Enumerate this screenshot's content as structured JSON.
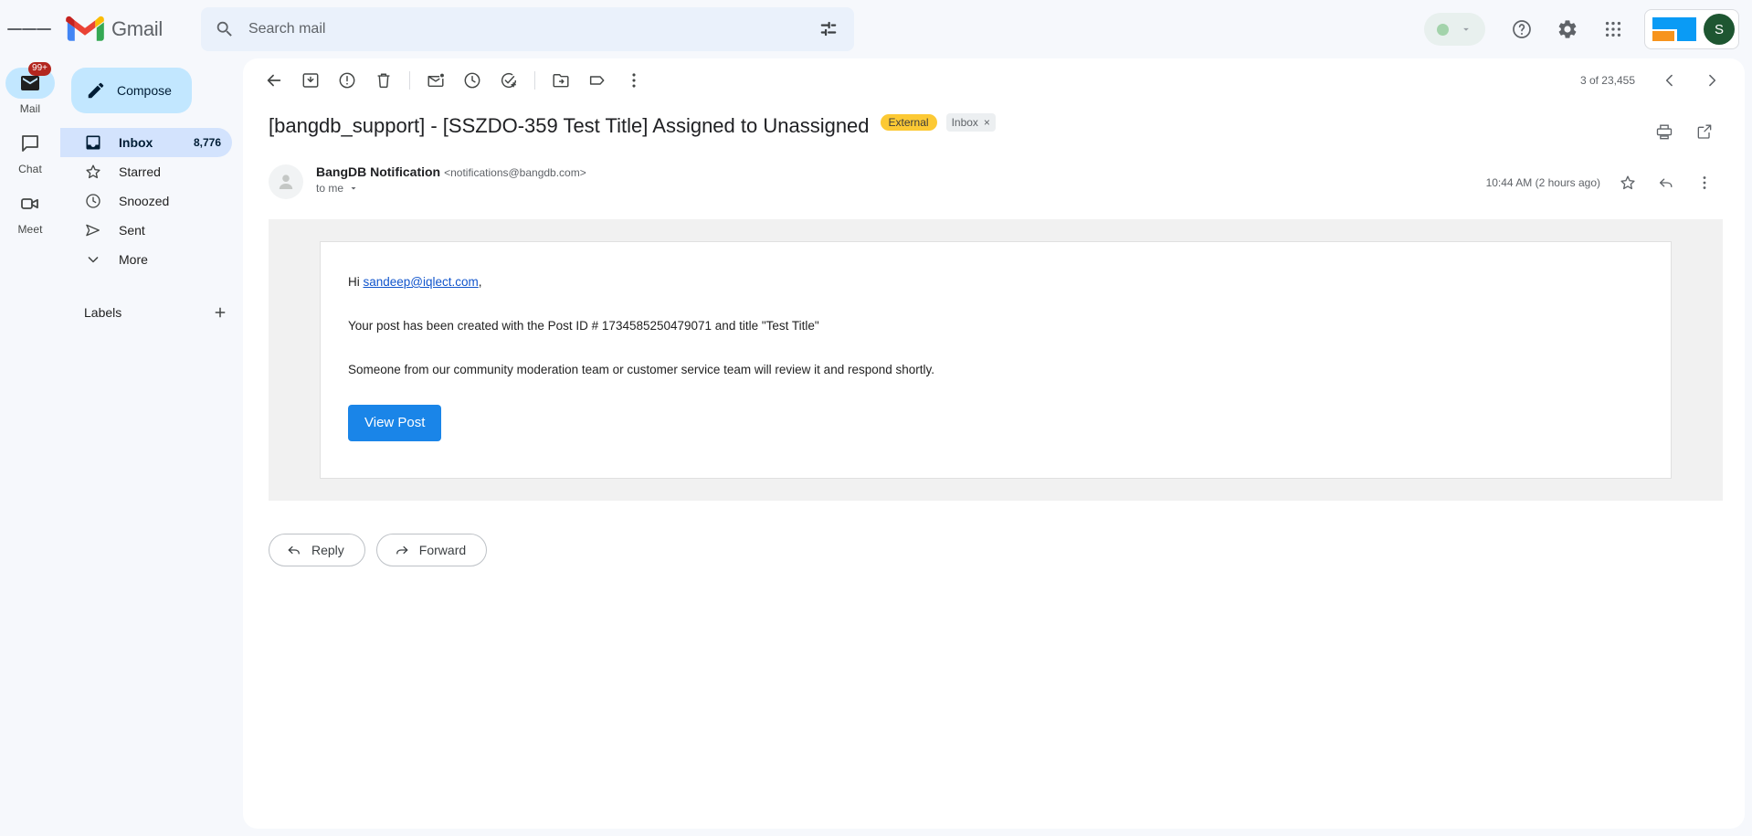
{
  "app": {
    "brand_name": "Gmail"
  },
  "search": {
    "placeholder": "Search mail",
    "value": "",
    "search_icon": "search-icon",
    "filter_icon": "tune-filter-icon"
  },
  "header": {
    "status_dot_color": "#a3d3ab",
    "help_icon": "help-circle-icon",
    "settings_icon": "gear-icon",
    "apps_icon": "apps-grid-icon",
    "avatar_initial": "S",
    "avatar_color": "#1e5631"
  },
  "rail": [
    {
      "label": "Mail",
      "icon": "mail-icon",
      "badge": "99+",
      "active": true
    },
    {
      "label": "Chat",
      "icon": "chat-bubble-icon",
      "badge": "",
      "active": false
    },
    {
      "label": "Meet",
      "icon": "video-camera-icon",
      "badge": "",
      "active": false
    }
  ],
  "sidebar": {
    "compose_label": "Compose",
    "compose_icon": "pencil-icon",
    "items": [
      {
        "label": "Inbox",
        "count": "8,776",
        "icon": "inbox-icon",
        "active": true
      },
      {
        "label": "Starred",
        "count": "",
        "icon": "star-icon",
        "active": false
      },
      {
        "label": "Snoozed",
        "count": "",
        "icon": "clock-icon",
        "active": false
      },
      {
        "label": "Sent",
        "count": "",
        "icon": "send-icon",
        "active": false
      },
      {
        "label": "More",
        "count": "",
        "icon": "chevron-down-icon",
        "active": false
      }
    ],
    "labels_title": "Labels",
    "labels_add_icon": "plus-icon"
  },
  "toolbar": {
    "back_icon": "arrow-left-icon",
    "archive_icon": "archive-icon",
    "spam_icon": "report-spam-icon",
    "delete_icon": "trash-icon",
    "unread_icon": "mark-unread-icon",
    "snooze_icon": "clock-snooze-icon",
    "tasks_icon": "add-to-tasks-icon",
    "move_icon": "move-to-folder-icon",
    "labels_icon": "label-tag-icon",
    "more_icon": "more-vertical-icon",
    "pager_text": "3 of 23,455",
    "prev_icon": "chevron-left-icon",
    "next_icon": "chevron-right-icon"
  },
  "email": {
    "subject": "[bangdb_support] - [SSZDO-359 Test Title] Assigned to Unassigned",
    "external_badge": "External",
    "inbox_chip": "Inbox",
    "inbox_chip_close": "×",
    "print_icon": "print-icon",
    "popout_icon": "open-in-new-icon",
    "sender_name": "BangDB Notification",
    "sender_email": "<notifications@bangdb.com>",
    "to_line": "to me",
    "to_caret_icon": "caret-down-icon",
    "timestamp": "10:44 AM (2 hours ago)",
    "star_icon": "star-outline-icon",
    "reply_icon": "reply-arrow-icon",
    "more_icon": "more-vertical-icon",
    "body": {
      "greeting_prefix": "Hi ",
      "greeting_link": "sandeep@iqlect.com",
      "greeting_suffix": ",",
      "paragraph_1": "Your post has been created with the Post ID # 1734585250479071 and title \"Test Title\"",
      "paragraph_2": "Someone from our community moderation team or customer service team will review it and respond shortly.",
      "cta_label": "View Post",
      "cta_color": "#1a85e8"
    }
  },
  "footer_actions": {
    "reply_label": "Reply",
    "reply_icon": "reply-arrow-icon",
    "forward_label": "Forward",
    "forward_icon": "forward-arrow-icon"
  }
}
